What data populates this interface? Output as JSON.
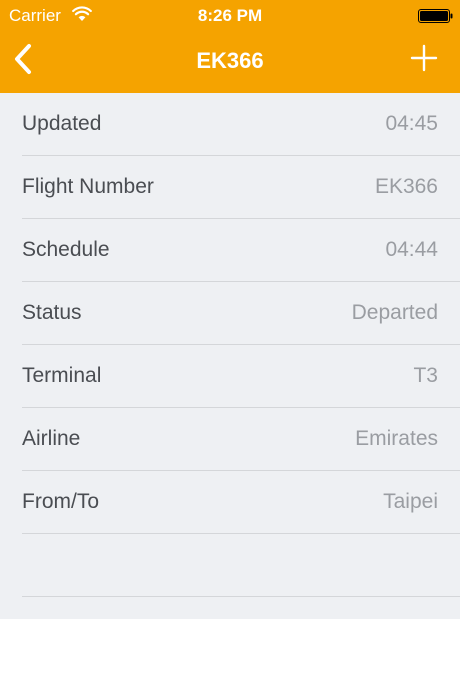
{
  "status_bar": {
    "carrier": "Carrier",
    "time": "8:26 PM",
    "wifi_icon": "wifi-icon",
    "battery_icon": "battery-icon"
  },
  "nav": {
    "title": "EK366",
    "back_icon": "chevron-left-icon",
    "add_icon": "plus-icon"
  },
  "colors": {
    "header": "#f5a300",
    "background": "#eef0f3",
    "label": "#4a4d52",
    "value": "#9a9da2"
  },
  "details": [
    {
      "label": "Updated",
      "value": "04:45"
    },
    {
      "label": "Flight Number",
      "value": "EK366"
    },
    {
      "label": "Schedule",
      "value": "04:44"
    },
    {
      "label": "Status",
      "value": "Departed"
    },
    {
      "label": "Terminal",
      "value": "T3"
    },
    {
      "label": "Airline",
      "value": "Emirates"
    },
    {
      "label": "From/To",
      "value": "Taipei"
    },
    {
      "label": "",
      "value": ""
    }
  ]
}
